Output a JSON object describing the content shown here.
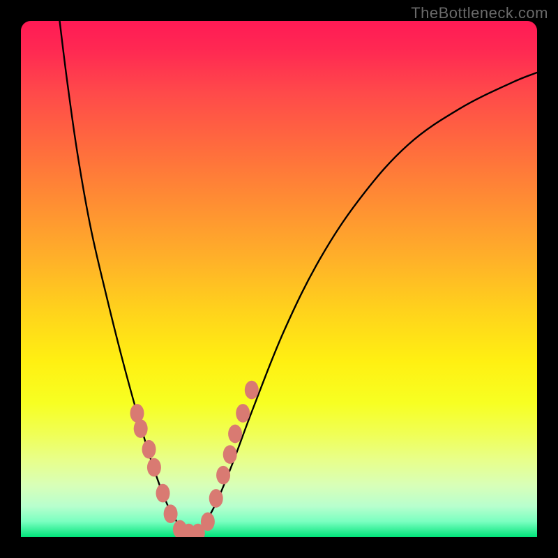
{
  "attribution": {
    "watermark": "TheBottleneck.com"
  },
  "colors": {
    "background": "#000000",
    "gradient_top": "#ff1a55",
    "gradient_mid": "#ffd21c",
    "gradient_bottom": "#00e47a",
    "curve": "#000000",
    "beads": "#d97a72"
  },
  "chart_data": {
    "type": "line",
    "title": "",
    "xlabel": "",
    "ylabel": "",
    "xlim": [
      0,
      1
    ],
    "ylim": [
      0,
      1
    ],
    "grid": false,
    "legend": false,
    "curve_left": {
      "description": "steep descending arc from top-left bending to a minimum near x≈0.30",
      "points": [
        {
          "x": 0.075,
          "y": 1.0
        },
        {
          "x": 0.09,
          "y": 0.88
        },
        {
          "x": 0.11,
          "y": 0.74
        },
        {
          "x": 0.135,
          "y": 0.6
        },
        {
          "x": 0.165,
          "y": 0.47
        },
        {
          "x": 0.195,
          "y": 0.35
        },
        {
          "x": 0.225,
          "y": 0.24
        },
        {
          "x": 0.255,
          "y": 0.14
        },
        {
          "x": 0.285,
          "y": 0.06
        },
        {
          "x": 0.315,
          "y": 0.01
        }
      ]
    },
    "curve_right": {
      "description": "ascending arc from minimum near x≈0.34 rising to upper-right edge",
      "points": [
        {
          "x": 0.315,
          "y": 0.01
        },
        {
          "x": 0.34,
          "y": 0.01
        },
        {
          "x": 0.37,
          "y": 0.05
        },
        {
          "x": 0.405,
          "y": 0.13
        },
        {
          "x": 0.45,
          "y": 0.25
        },
        {
          "x": 0.51,
          "y": 0.4
        },
        {
          "x": 0.58,
          "y": 0.54
        },
        {
          "x": 0.66,
          "y": 0.66
        },
        {
          "x": 0.75,
          "y": 0.76
        },
        {
          "x": 0.85,
          "y": 0.83
        },
        {
          "x": 0.95,
          "y": 0.88
        },
        {
          "x": 1.0,
          "y": 0.9
        }
      ]
    },
    "beads_left": [
      {
        "x": 0.225,
        "y": 0.24
      },
      {
        "x": 0.232,
        "y": 0.21
      },
      {
        "x": 0.248,
        "y": 0.17
      },
      {
        "x": 0.258,
        "y": 0.135
      },
      {
        "x": 0.275,
        "y": 0.085
      },
      {
        "x": 0.29,
        "y": 0.045
      },
      {
        "x": 0.308,
        "y": 0.015
      },
      {
        "x": 0.325,
        "y": 0.008
      }
    ],
    "beads_right": [
      {
        "x": 0.343,
        "y": 0.008
      },
      {
        "x": 0.362,
        "y": 0.03
      },
      {
        "x": 0.378,
        "y": 0.075
      },
      {
        "x": 0.392,
        "y": 0.12
      },
      {
        "x": 0.405,
        "y": 0.16
      },
      {
        "x": 0.415,
        "y": 0.2
      },
      {
        "x": 0.43,
        "y": 0.24
      },
      {
        "x": 0.447,
        "y": 0.285
      }
    ],
    "bead_radius": 0.018
  }
}
